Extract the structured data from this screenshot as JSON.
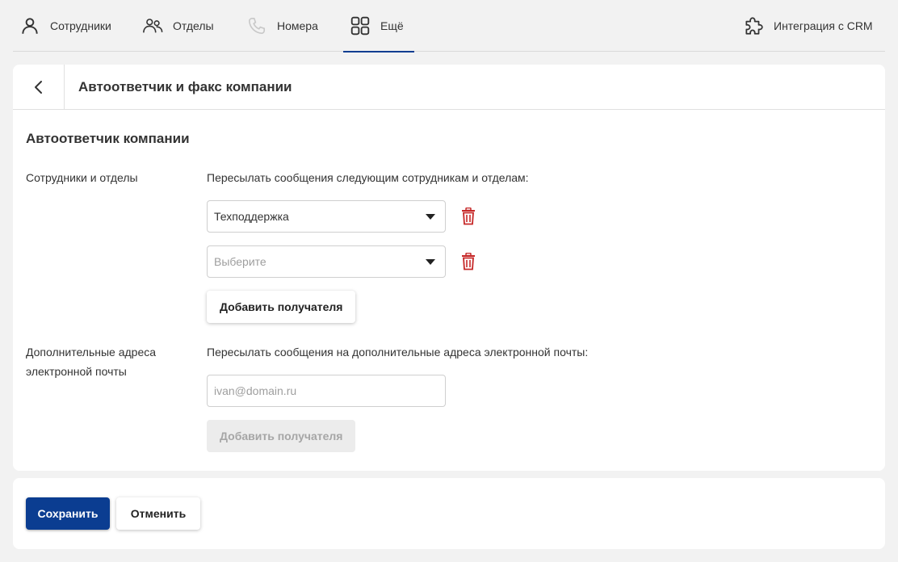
{
  "nav": {
    "employees": "Сотрудники",
    "departments": "Отделы",
    "numbers": "Номера",
    "more": "Ещё",
    "crm": "Интеграция с CRM"
  },
  "header": {
    "title": "Автоответчик и факс компании"
  },
  "section": {
    "title": "Автоответчик компании"
  },
  "recipients": {
    "label": "Сотрудники и отделы",
    "description": "Пересылать сообщения следующим сотрудникам и отделам:",
    "selects": [
      {
        "value": "Техподдержка",
        "placeholder": ""
      },
      {
        "value": "",
        "placeholder": "Выберите"
      }
    ],
    "add_label": "Добавить получателя"
  },
  "emails": {
    "label": "Дополнительные адреса электронной почты",
    "description": "Пересылать сообщения на дополнительные адреса электронной почты:",
    "input_placeholder": "ivan@domain.ru",
    "add_label": "Добавить получателя"
  },
  "footer": {
    "save_label": "Сохранить",
    "cancel_label": "Отменить"
  },
  "colors": {
    "accent": "#0b3d91",
    "danger": "#c62828",
    "background": "#f2f2f2"
  },
  "icons": {
    "employees": "person-icon",
    "departments": "group-icon",
    "numbers": "phone-icon",
    "more": "grid-icon",
    "crm": "puzzle-icon",
    "back": "chevron-left-icon",
    "delete": "trash-icon",
    "dropdown": "caret-down-icon"
  }
}
